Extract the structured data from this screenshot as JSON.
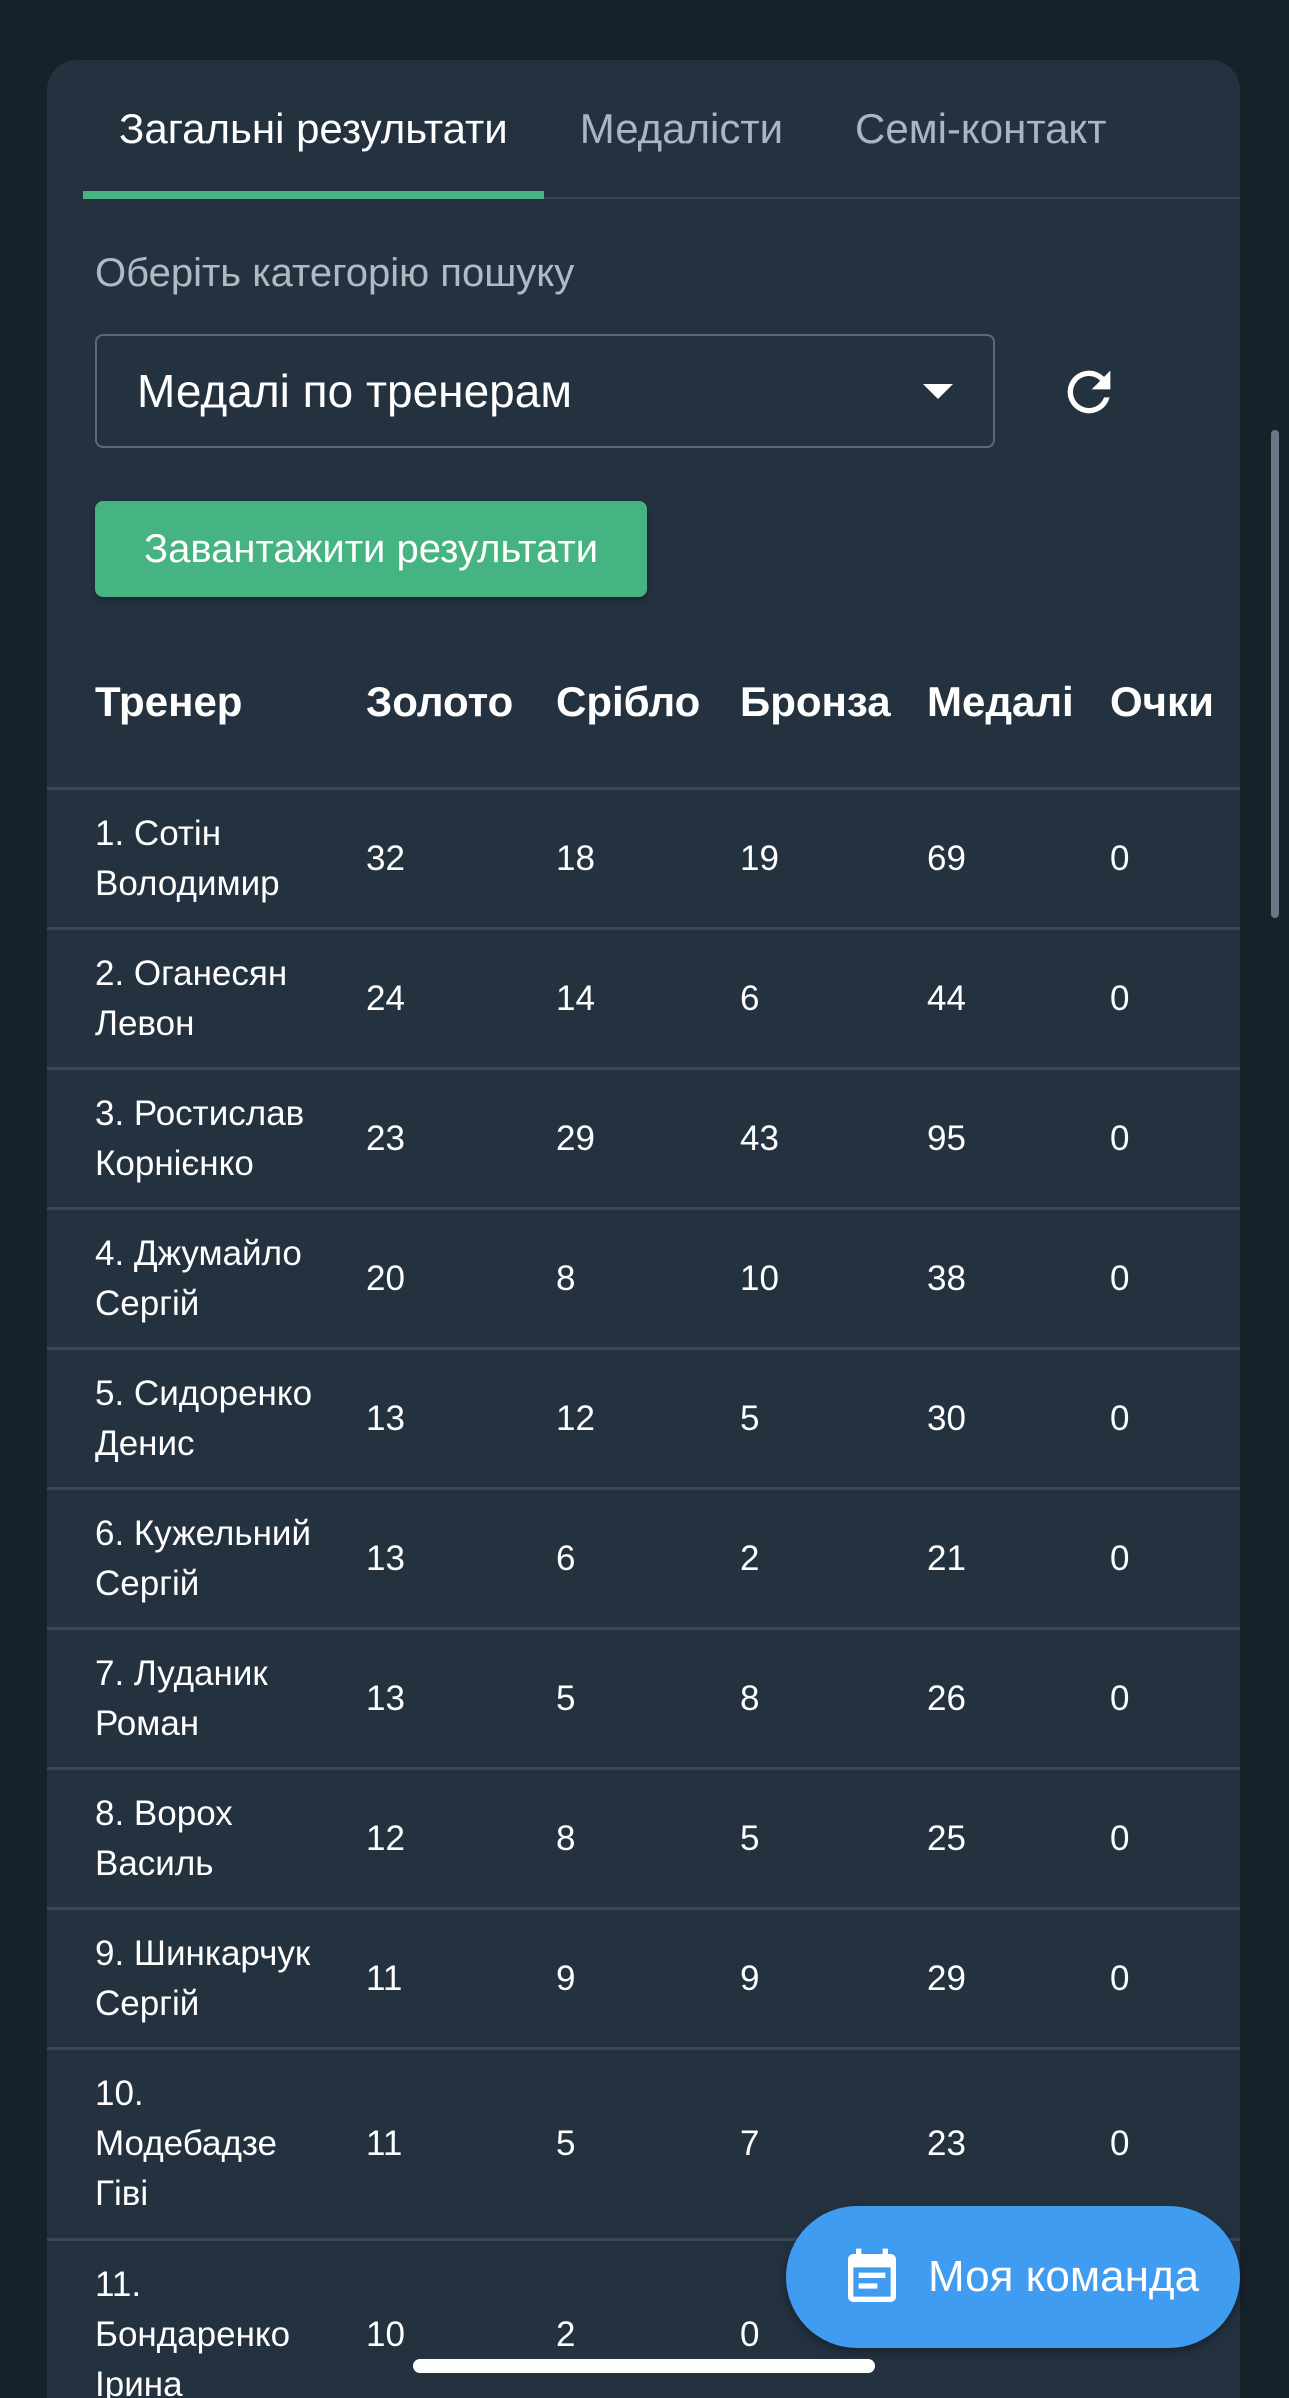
{
  "tabs": [
    {
      "label": "Загальні результати",
      "active": true
    },
    {
      "label": "Медалісти",
      "active": false
    },
    {
      "label": "Семі-контакт",
      "active": false
    }
  ],
  "search": {
    "label": "Оберіть категорію пошуку",
    "selected": "Медалі по тренерам",
    "refresh_icon": "refresh-icon"
  },
  "load_button": "Завантажити результати",
  "table": {
    "headers": [
      "Тренер",
      "Золото",
      "Срібло",
      "Бронза",
      "Медалі",
      "Очки"
    ],
    "rows": [
      {
        "name": "1. Сотін Володимир",
        "gold": "32",
        "silver": "18",
        "bronze": "19",
        "medals": "69",
        "points": "0"
      },
      {
        "name": "2. Оганесян Левон",
        "gold": "24",
        "silver": "14",
        "bronze": "6",
        "medals": "44",
        "points": "0"
      },
      {
        "name": "3. Ростислав Корнієнко",
        "gold": "23",
        "silver": "29",
        "bronze": "43",
        "medals": "95",
        "points": "0"
      },
      {
        "name": "4. Джумайло Сергій",
        "gold": "20",
        "silver": "8",
        "bronze": "10",
        "medals": "38",
        "points": "0"
      },
      {
        "name": "5. Сидоренко Денис",
        "gold": "13",
        "silver": "12",
        "bronze": "5",
        "medals": "30",
        "points": "0"
      },
      {
        "name": "6. Кужельний Сергій",
        "gold": "13",
        "silver": "6",
        "bronze": "2",
        "medals": "21",
        "points": "0"
      },
      {
        "name": "7. Луданик Роман",
        "gold": "13",
        "silver": "5",
        "bronze": "8",
        "medals": "26",
        "points": "0"
      },
      {
        "name": "8. Ворох Василь",
        "gold": "12",
        "silver": "8",
        "bronze": "5",
        "medals": "25",
        "points": "0"
      },
      {
        "name": "9. Шинкарчук Сергій",
        "gold": "11",
        "silver": "9",
        "bronze": "9",
        "medals": "29",
        "points": "0"
      },
      {
        "name": "10. Модебадзе Гіві",
        "gold": "11",
        "silver": "5",
        "bronze": "7",
        "medals": "23",
        "points": "0"
      },
      {
        "name": "11. Бондаренко Ірина",
        "gold": "10",
        "silver": "2",
        "bronze": "0",
        "medals": "",
        "points": ""
      }
    ]
  },
  "fab": {
    "label": "Моя команда",
    "icon": "calendar-note-icon"
  },
  "colors": {
    "background": "#17212a",
    "card": "#243240",
    "accent": "#45b482",
    "fab": "#3f9cf0",
    "divider": "#3a4856"
  }
}
